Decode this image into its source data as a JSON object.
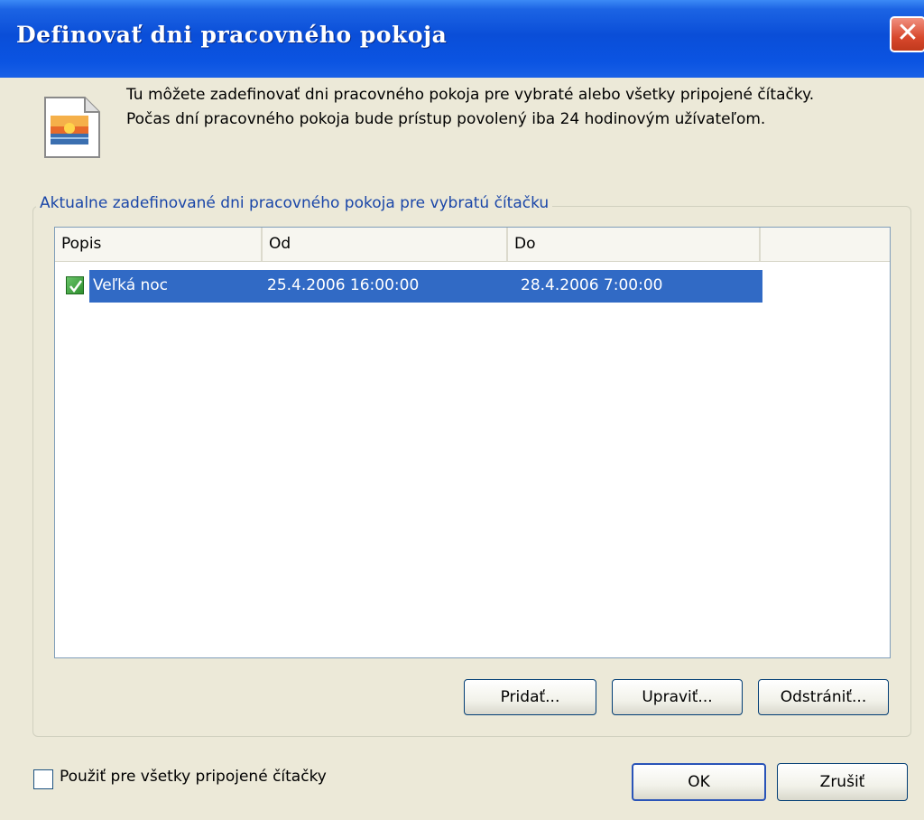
{
  "window": {
    "title": "Definovať dni pracovného pokoja",
    "close_label": "✕"
  },
  "description": {
    "line1": "Tu môžete zadefinovať dni pracovného pokoja pre vybraté alebo všetky pripojené čítačky.",
    "line2": "Počas dní pracovného pokoja bude prístup povolený iba 24 hodinovým užívateľom."
  },
  "group": {
    "title": "Aktualne zadefinované dni pracovného pokoja pre vybratú čítačku"
  },
  "table": {
    "columns": [
      "Popis",
      "Od",
      "Do"
    ],
    "rows": [
      {
        "checked": true,
        "selected": true,
        "popis": "Veľká noc",
        "od": "25.4.2006 16:00:00",
        "do": "28.4.2006 7:00:00"
      }
    ]
  },
  "buttons": {
    "add": "Pridať...",
    "edit": "Upraviť...",
    "remove": "Odstrániť...",
    "ok": "OK",
    "cancel": "Zrušiť"
  },
  "apply_all": {
    "label": "Použiť pre všetky pripojené čítačky",
    "checked": false
  },
  "colors": {
    "titlebar": "#0a4ed8",
    "selection": "#316ac5",
    "group_title": "#1a46a8"
  }
}
